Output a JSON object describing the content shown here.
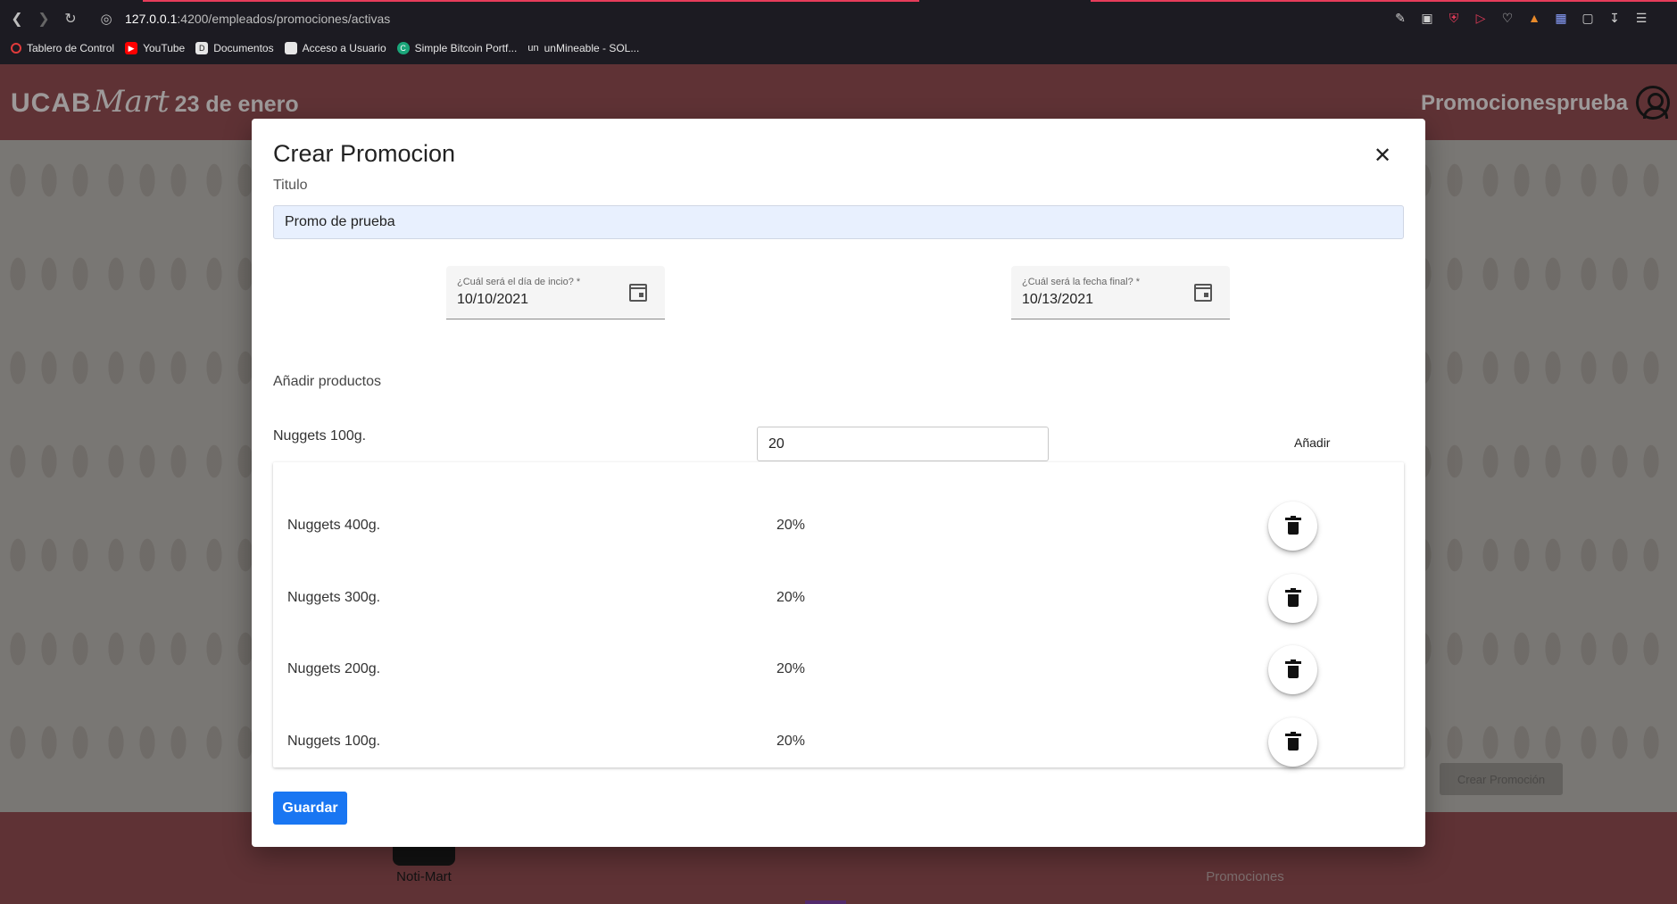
{
  "browser": {
    "url_host": "127.0.0.1",
    "url_path": ":4200/empleados/promociones/activas",
    "bookmarks": [
      {
        "label": "Tablero de Control",
        "color": "#e03b3b"
      },
      {
        "label": "YouTube",
        "color": "#ff0000"
      },
      {
        "label": "Documentos",
        "color": "#444444"
      },
      {
        "label": "Acceso a Usuario",
        "color": "#888888"
      },
      {
        "label": "Simple Bitcoin Portf...",
        "color": "#1aa67a"
      },
      {
        "label": "unMineable - SOL...",
        "color": "#333333",
        "prefix": "un"
      }
    ]
  },
  "app": {
    "brand_ucab": "UCAB",
    "brand_mart": "Mart",
    "brand_date": "23 de enero",
    "user_name": "Promocionesprueba",
    "bg_create_button": "Crear Promoción",
    "footer": {
      "left_label": "Noti-Mart",
      "right_label": "Promociones"
    }
  },
  "dialog": {
    "title": "Crear Promocion",
    "close_symbol": "✕",
    "titulo_label": "Titulo",
    "titulo_value": "Promo de prueba",
    "start_date": {
      "label": "¿Cuál será el día de incio? *",
      "value": "10/10/2021"
    },
    "end_date": {
      "label": "¿Cuál será la fecha final? *",
      "value": "10/13/2021"
    },
    "add_products_label": "Añadir productos",
    "selected_product": "Nuggets 100g.",
    "percent_value": "20",
    "add_button": "Añadir",
    "products": [
      {
        "name": "Nuggets 400g.",
        "percent": "20%"
      },
      {
        "name": "Nuggets 300g.",
        "percent": "20%"
      },
      {
        "name": "Nuggets 200g.",
        "percent": "20%"
      },
      {
        "name": "Nuggets 100g.",
        "percent": "20%"
      }
    ],
    "save_button": "Guardar"
  }
}
